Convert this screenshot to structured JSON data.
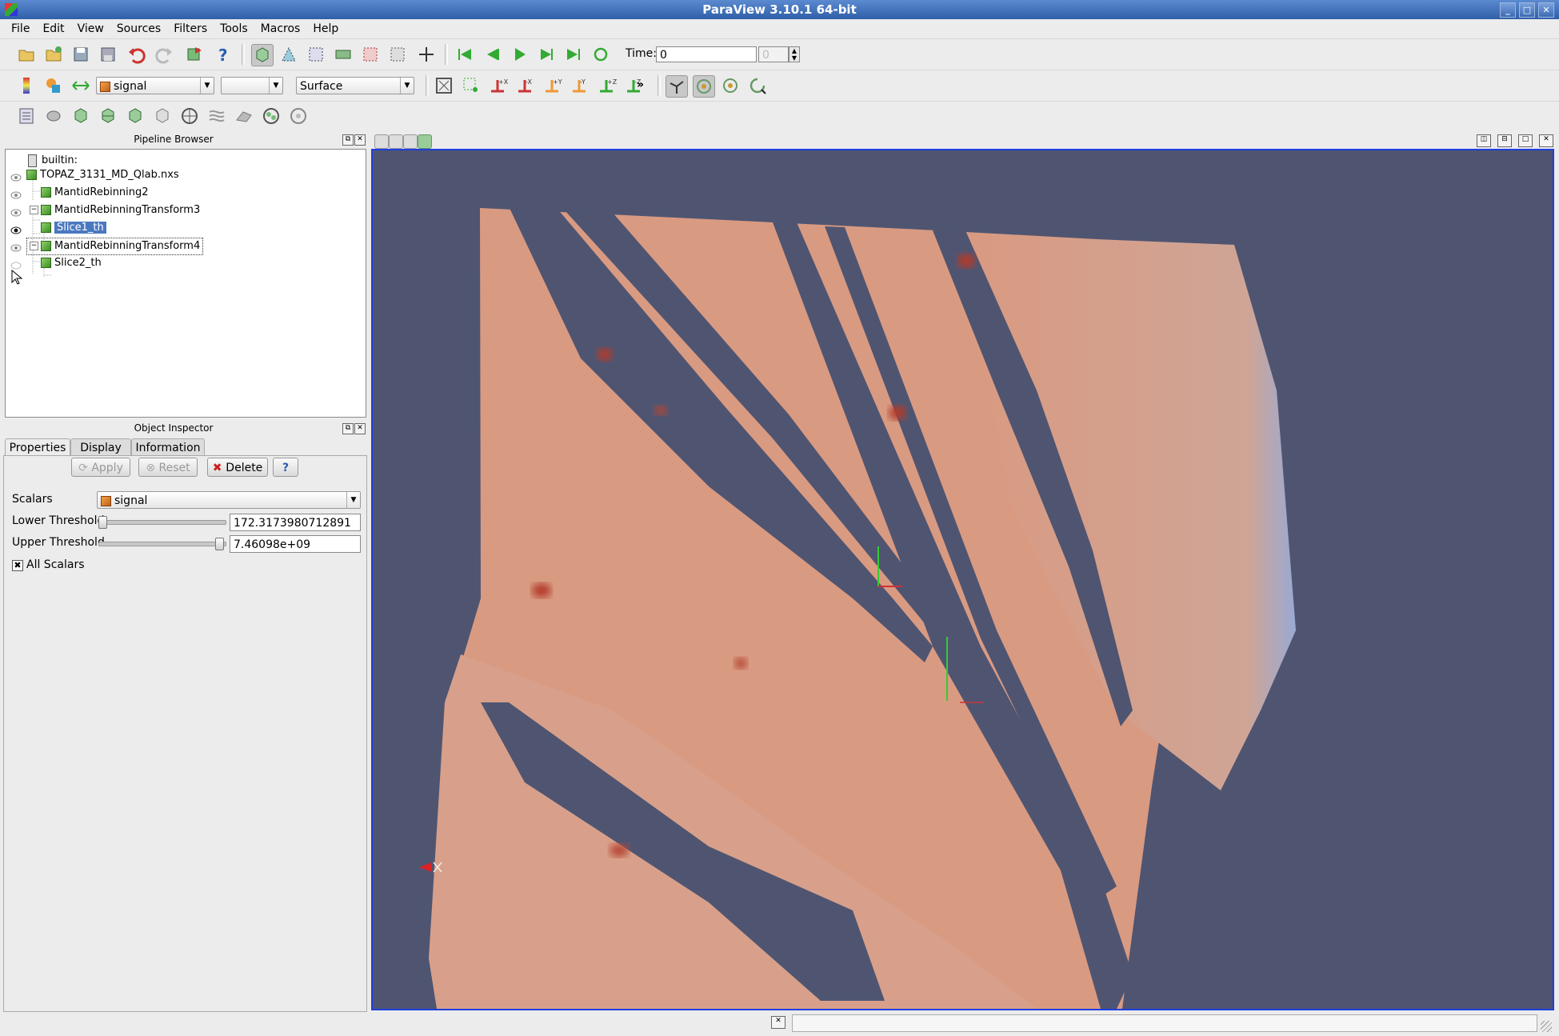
{
  "window": {
    "title": "ParaView 3.10.1 64-bit",
    "minimize": "_",
    "maximize": "□",
    "close": "✕"
  },
  "menu": [
    "File",
    "Edit",
    "View",
    "Sources",
    "Filters",
    "Tools",
    "Macros",
    "Help"
  ],
  "toolbar": {
    "time_label": "Time:",
    "time_value": "0",
    "time_index": "0",
    "color_by": "signal",
    "component": "",
    "representation": "Surface",
    "more": "»"
  },
  "pipeline_browser": {
    "title": "Pipeline Browser",
    "items": [
      {
        "label": "builtin:",
        "visible": null
      },
      {
        "label": "TOPAZ_3131_MD_Qlab.nxs",
        "visible": true
      },
      {
        "label": "MantidRebinning2",
        "visible": true
      },
      {
        "label": "MantidRebinningTransform3",
        "visible": true
      },
      {
        "label": "Slice1_th",
        "visible": true,
        "selected": true
      },
      {
        "label": "MantidRebinningTransform4",
        "visible": true
      },
      {
        "label": "Slice2_th",
        "visible": false
      }
    ]
  },
  "object_inspector": {
    "title": "Object Inspector",
    "tabs": [
      "Properties",
      "Display",
      "Information"
    ],
    "active_tab": "Properties",
    "apply_label": "Apply",
    "reset_label": "Reset",
    "delete_label": "Delete",
    "help_label": "?",
    "scalars_label": "Scalars",
    "scalars_value": "signal",
    "lower_threshold_label": "Lower Threshold",
    "lower_threshold_value": "172.3173980712891",
    "upper_threshold_label": "Upper Threshold",
    "upper_threshold_value": "7.46098e+09",
    "all_scalars_label": "All Scalars",
    "all_scalars_checked": true
  },
  "colors": {
    "viewport_bg": "#4f5571",
    "viewport_border": "#1f3fe0",
    "slice_fill": "#d99a82",
    "selection": "#4a78c0"
  }
}
